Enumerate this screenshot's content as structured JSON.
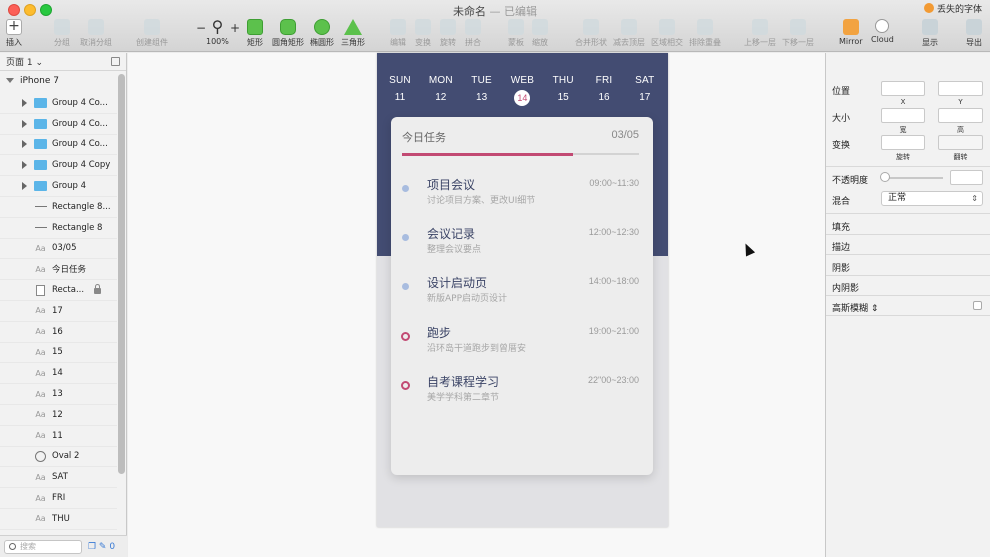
{
  "window": {
    "title": "未命名",
    "subtitle": "— 已编辑",
    "lost_font_label": "丢失的字体"
  },
  "toolbar": {
    "insert": "插入",
    "group": "分组",
    "ungroup": "取消分组",
    "create_symbol": "创建组件",
    "zoom_value": "100%",
    "zoom_minus": "−",
    "zoom_plus": "+",
    "rectangle": "矩形",
    "rounded_rectangle": "圆角矩形",
    "oval": "椭圆形",
    "triangle": "三角形",
    "edit": "编辑",
    "transform": "变换",
    "rotate": "旋转",
    "flatten": "拼合",
    "mask": "蒙板",
    "scale": "缩放",
    "union": "合并形状",
    "subtract": "减去顶层",
    "intersect": "区域相交",
    "difference": "排除重叠",
    "forward": "上移一层",
    "backward": "下移一层",
    "mirror": "Mirror",
    "cloud": "Cloud",
    "display": "显示",
    "export": "导出"
  },
  "sidebar": {
    "page_selector": "页面 1",
    "artboard": "iPhone 7",
    "layers": [
      {
        "type": "group",
        "label": "Group 4 Co..."
      },
      {
        "type": "group",
        "label": "Group 4 Co..."
      },
      {
        "type": "group",
        "label": "Group 4 Co..."
      },
      {
        "type": "group",
        "label": "Group 4 Copy"
      },
      {
        "type": "group",
        "label": "Group 4"
      },
      {
        "type": "line",
        "label": "Rectangle 8..."
      },
      {
        "type": "line",
        "label": "Rectangle 8"
      },
      {
        "type": "text",
        "label": "03/05"
      },
      {
        "type": "text",
        "label": "今日任务"
      },
      {
        "type": "rect",
        "label": "Recta...",
        "locked": true
      },
      {
        "type": "text",
        "label": "17"
      },
      {
        "type": "text",
        "label": "16"
      },
      {
        "type": "text",
        "label": "15"
      },
      {
        "type": "text",
        "label": "14"
      },
      {
        "type": "text",
        "label": "13"
      },
      {
        "type": "text",
        "label": "12"
      },
      {
        "type": "text",
        "label": "11"
      },
      {
        "type": "oval",
        "label": "Oval 2"
      },
      {
        "type": "text",
        "label": "SAT"
      },
      {
        "type": "text",
        "label": "FRI"
      },
      {
        "type": "text",
        "label": "THU"
      }
    ],
    "text_layer_icon": "Aa",
    "search_placeholder": "搜索",
    "footer_count": "0"
  },
  "artboard": {
    "days": [
      {
        "name": "SUN",
        "date": "11"
      },
      {
        "name": "MON",
        "date": "12"
      },
      {
        "name": "TUE",
        "date": "13"
      },
      {
        "name": "WEB",
        "date": "14",
        "active": true
      },
      {
        "name": "THU",
        "date": "15"
      },
      {
        "name": "FRI",
        "date": "16"
      },
      {
        "name": "SAT",
        "date": "17"
      }
    ],
    "card": {
      "title": "今日任务",
      "date": "03/05",
      "progress": 0.72,
      "tasks": [
        {
          "name": "项目会议",
          "desc": "讨论项目方案、更改UI细节",
          "time": "09:00~11:30",
          "marker": "dot"
        },
        {
          "name": "会议记录",
          "desc": "整理会议要点",
          "time": "12:00~12:30",
          "marker": "dot"
        },
        {
          "name": "设计启动页",
          "desc": "新版APP启动页设计",
          "time": "14:00~18:00",
          "marker": "dot"
        },
        {
          "name": "跑步",
          "desc": "沿环岛干道跑步到曾厝安",
          "time": "19:00~21:00",
          "marker": "ring"
        },
        {
          "name": "自考课程学习",
          "desc": "美学学科第二章节",
          "time": "22\"00~23:00",
          "marker": "ring"
        }
      ]
    },
    "colors": {
      "header": "#434c72",
      "accent": "#c24a73",
      "dot": "#a8bcdf"
    }
  },
  "inspector": {
    "position": "位置",
    "x": "X",
    "y": "Y",
    "size": "大小",
    "width": "宽",
    "height": "高",
    "transform": "变换",
    "rotate": "旋转",
    "flip": "翻转",
    "opacity": "不透明度",
    "blend": "混合",
    "blend_value": "正常",
    "fill": "填充",
    "border": "描边",
    "shadow": "阴影",
    "inner_shadow": "内阴影",
    "gaussian_blur": "高斯模糊"
  }
}
